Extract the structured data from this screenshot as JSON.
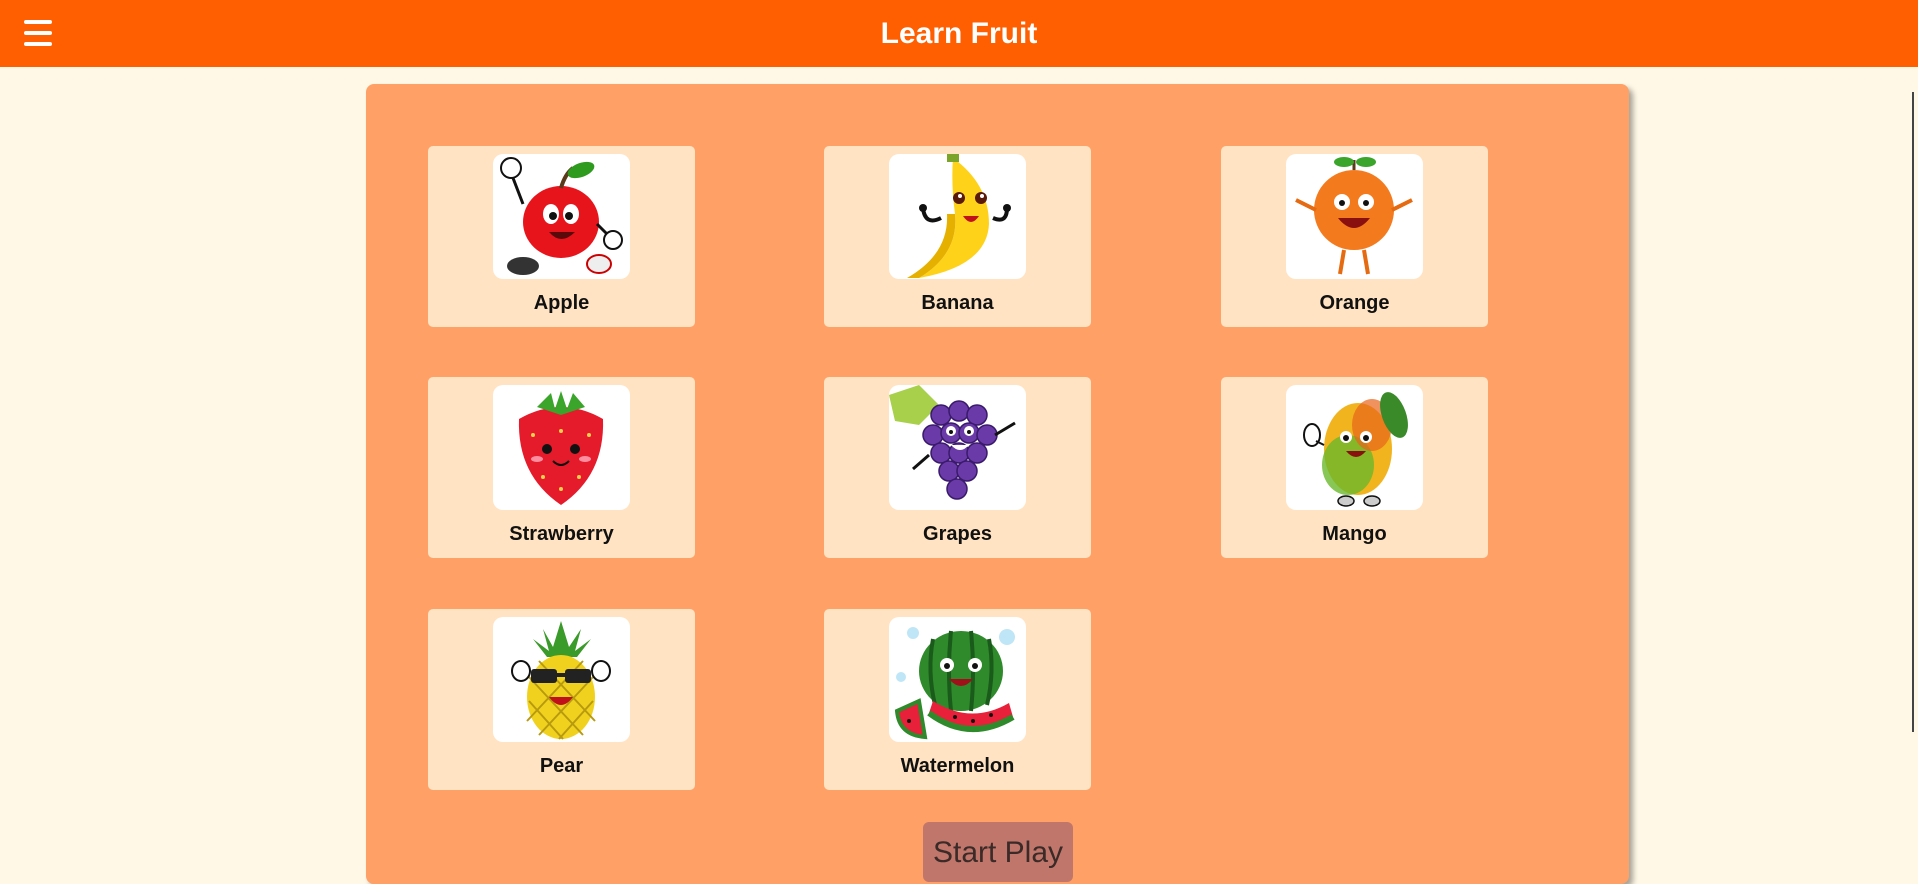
{
  "header": {
    "title": "Learn Fruit",
    "menu_icon": "hamburger-menu-icon"
  },
  "colors": {
    "header_bg": "#ff5f00",
    "page_bg": "#fff8e7",
    "panel_bg": "#ffa066",
    "card_bg": "#ffe3c2",
    "button_bg": "#c0766a"
  },
  "fruits": [
    {
      "label": "Apple",
      "icon": "apple-icon"
    },
    {
      "label": "Banana",
      "icon": "banana-icon"
    },
    {
      "label": "Orange",
      "icon": "orange-icon"
    },
    {
      "label": "Strawberry",
      "icon": "strawberry-icon"
    },
    {
      "label": "Grapes",
      "icon": "grapes-icon"
    },
    {
      "label": "Mango",
      "icon": "mango-icon"
    },
    {
      "label": "Pear",
      "icon": "pineapple-icon"
    },
    {
      "label": "Watermelon",
      "icon": "watermelon-icon"
    }
  ],
  "actions": {
    "start_label": "Start Play"
  }
}
